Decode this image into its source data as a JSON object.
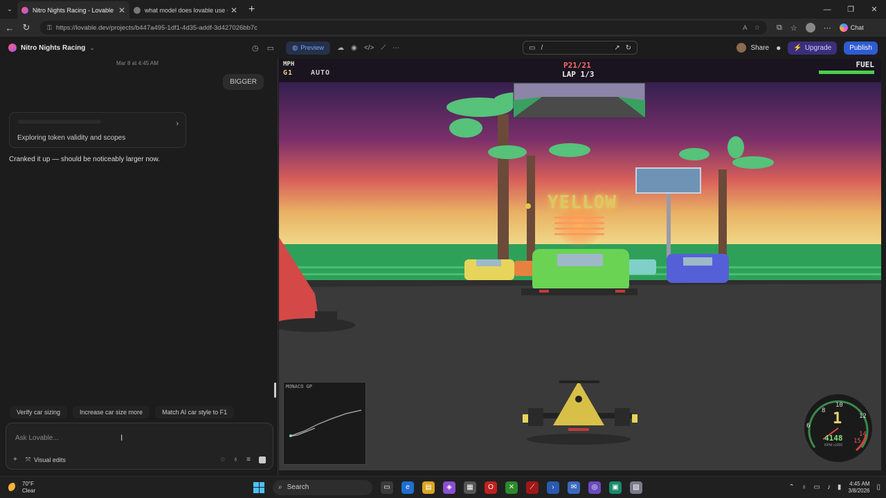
{
  "browser": {
    "tabs": [
      {
        "title": "Nitro Nights Racing - Lovable",
        "active": true
      },
      {
        "title": "what model does lovable use - Go",
        "active": false
      }
    ],
    "url": "https://lovable.dev/projects/b447a495-1df1-4d35-addf-3d427026bb7c",
    "chat_label": "Chat"
  },
  "app": {
    "project_name": "Nitro Nights Racing",
    "preview_label": "Preview",
    "path": "/",
    "share_label": "Share",
    "upgrade_label": "Upgrade",
    "publish_label": "Publish"
  },
  "chat": {
    "timestamp": "Mar 8 at 4:45 AM",
    "user_message": "BIGGER",
    "thinking_label": "Exploring token validity and scopes",
    "reply": "Cranked it up — should be noticeably larger now.",
    "suggestions": [
      "Verify car sizing",
      "Increase car size more",
      "Match AI car style to F1"
    ],
    "input_placeholder": "Ask Lovable...",
    "visual_edits_label": "Visual edits"
  },
  "game": {
    "mph_label": "MPH",
    "gear_label": "G1",
    "mode_label": "AUTO",
    "position": "P21/21",
    "lap": "LAP 1/3",
    "fuel_label": "FUEL",
    "fuel_level": 1.0,
    "flag_text": "YELLOW",
    "track_name": "MONACO GP",
    "gauge_gear": "1",
    "rpm": "4148",
    "rpm_unit": "RPM x1000",
    "gauge_ticks": [
      "6",
      "8",
      "10",
      "12",
      "14",
      "15"
    ]
  },
  "taskbar": {
    "temperature": "70°F",
    "condition": "Clear",
    "search_placeholder": "Search",
    "time": "4:45 AM",
    "date": "3/8/2026"
  },
  "colors": {
    "accent": "#2f5bd3",
    "upgrade": "#3a2f7a",
    "preview": "#6fa8ff"
  }
}
